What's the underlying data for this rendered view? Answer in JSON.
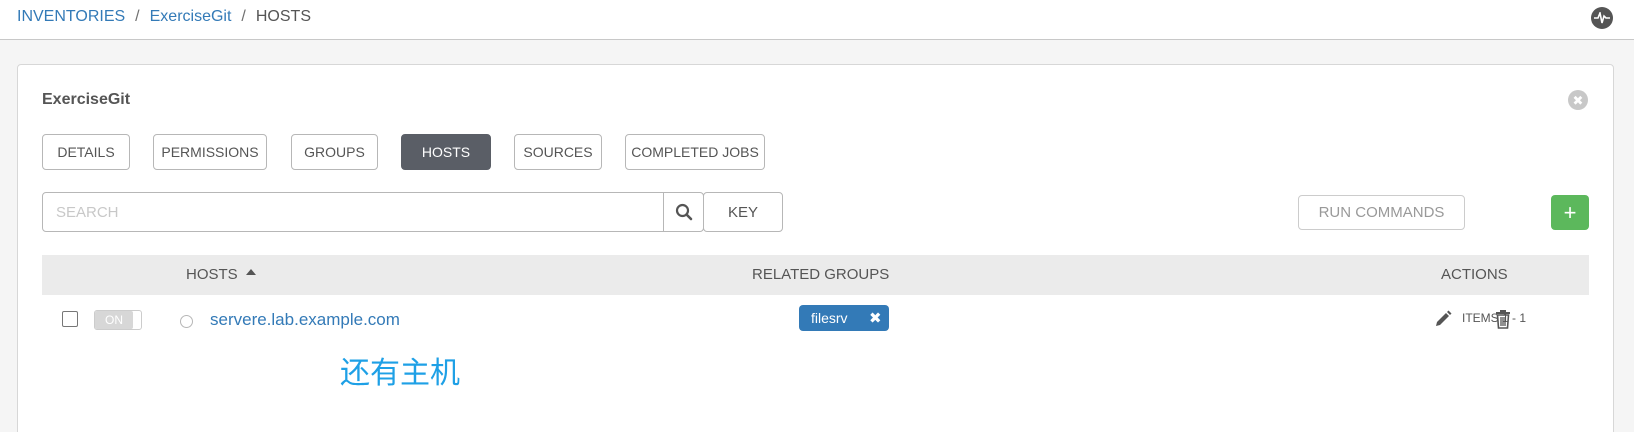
{
  "breadcrumb": {
    "inventories": "INVENTORIES",
    "sep1": "/",
    "inventory": "ExerciseGit",
    "sep2": "/",
    "current": "HOSTS"
  },
  "panel": {
    "title": "ExerciseGit",
    "close": "✖"
  },
  "tabs": [
    {
      "label": "DETAILS",
      "active": false
    },
    {
      "label": "PERMISSIONS",
      "active": false
    },
    {
      "label": "GROUPS",
      "active": false
    },
    {
      "label": "HOSTS",
      "active": true
    },
    {
      "label": "SOURCES",
      "active": false
    },
    {
      "label": "COMPLETED JOBS",
      "active": false
    }
  ],
  "toolbar": {
    "search_placeholder": "SEARCH",
    "key_label": "KEY",
    "run_commands_label": "RUN COMMANDS",
    "add_label": "+"
  },
  "table": {
    "columns": {
      "hosts": "HOSTS",
      "related_groups": "RELATED GROUPS",
      "actions": "ACTIONS"
    },
    "rows": [
      {
        "toggle": "ON",
        "host": "servere.lab.example.com",
        "groups": [
          "filesrv"
        ]
      }
    ]
  },
  "annotation": "还有主机",
  "pagination": {
    "items_label": "ITEMS  1 - 1"
  },
  "icons": {
    "activity": "activity-stream-icon",
    "search": "search-icon",
    "edit": "pencil-icon",
    "delete": "trash-icon",
    "close": "close-icon",
    "sort": "sort-ascending-icon"
  },
  "colors": {
    "link": "#337ab7",
    "active_tab": "#5a5e66",
    "add_button": "#5cb85c",
    "tag": "#337ab7",
    "annotation": "#1ea0e6"
  }
}
